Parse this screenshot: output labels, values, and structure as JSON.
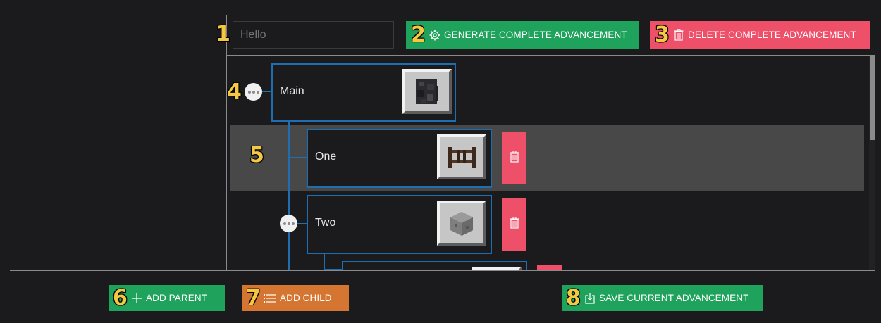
{
  "header": {
    "name_input": {
      "value": "",
      "placeholder": "Hello"
    },
    "generate_label": "GENERATE COMPLETE ADVANCEMENT",
    "delete_label": "DELETE COMPLETE ADVANCEMENT"
  },
  "tree": {
    "nodes": [
      {
        "label": "Main",
        "icon": "blackstone-block-icon"
      },
      {
        "label": "One",
        "icon": "dark-oak-fence-gate-icon"
      },
      {
        "label": "Two",
        "icon": "stone-block-icon"
      }
    ]
  },
  "footer": {
    "add_parent_label": "ADD PARENT",
    "add_child_label": "ADD CHILD",
    "save_label": "SAVE CURRENT ADVANCEMENT"
  },
  "callouts": [
    "1",
    "2",
    "3",
    "4",
    "5",
    "6",
    "7",
    "8"
  ],
  "colors": {
    "background": "#1b1b1d",
    "green": "#1fa25b",
    "red": "#ef5069",
    "orange": "#d57532",
    "tree_blue": "#1f6fb0",
    "highlight_row": "#484848",
    "callout": "#f5c842"
  }
}
